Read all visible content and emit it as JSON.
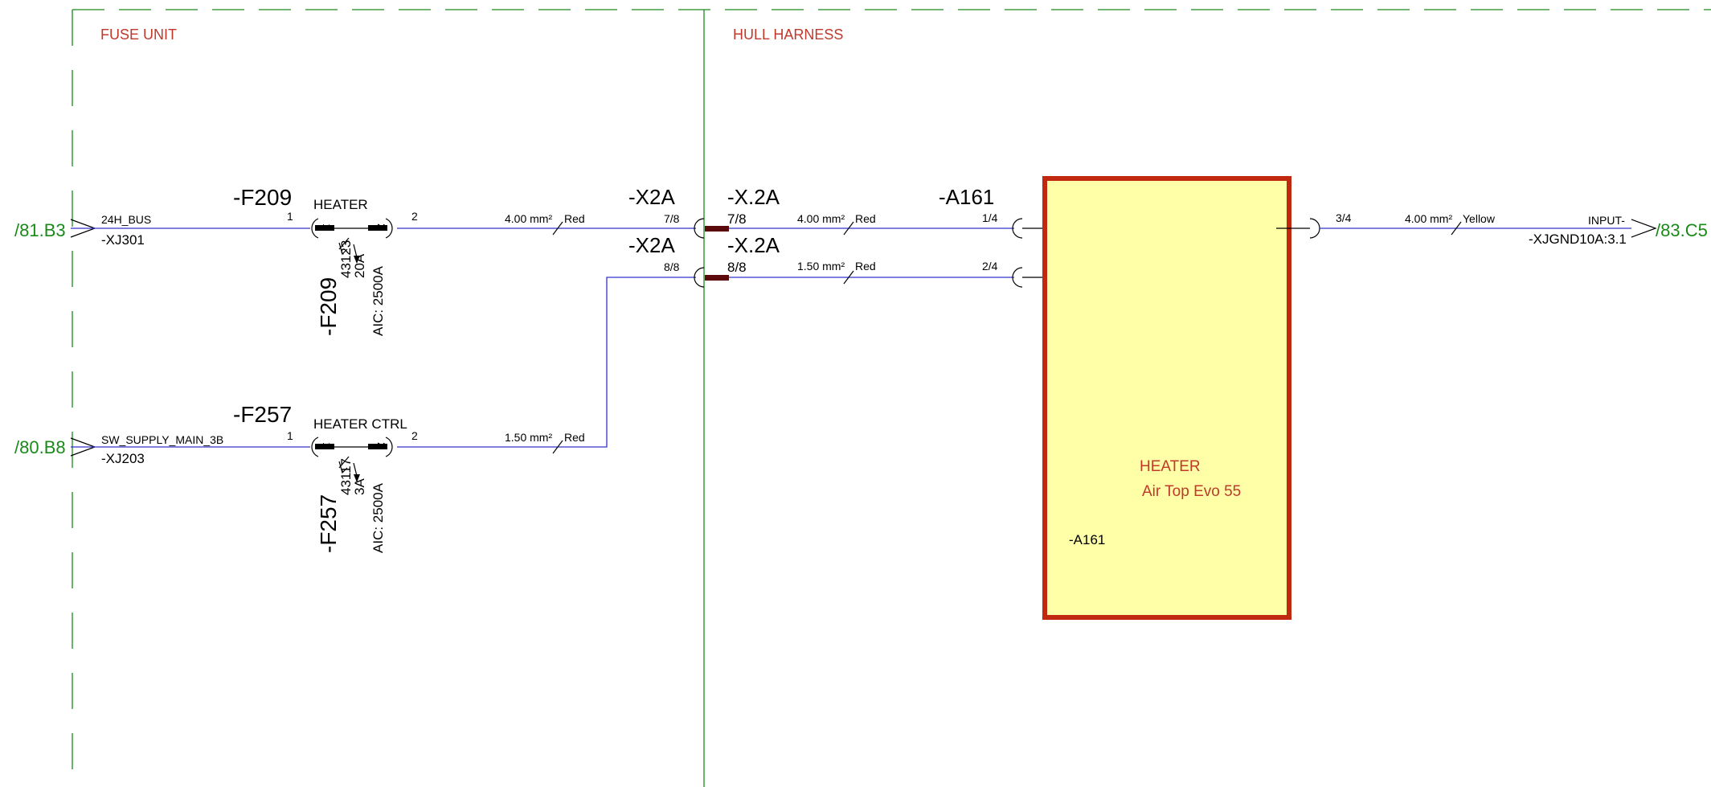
{
  "areas": {
    "fuse_unit": "FUSE UNIT",
    "hull_harness": "HULL HARNESS"
  },
  "refs": {
    "in1": "/81.B3",
    "in2": "/80.B8",
    "out1": "/83.C5"
  },
  "wire1": {
    "bus": "24H_BUS",
    "connector": "-XJ301",
    "fuse_tag": "-F209",
    "fuse_name": "HEATER",
    "pin_in": "1",
    "pin_out": "2",
    "spec_size": "4.00 mm²",
    "spec_color": "Red",
    "fuse_tag_v": "-F209",
    "fuse_part": "43123",
    "fuse_rating": "20A",
    "fuse_aic": "AIC: 2500A"
  },
  "wire2": {
    "bus": "SW_SUPPLY_MAIN_3B",
    "connector": "-XJ203",
    "fuse_tag": "-F257",
    "fuse_name": "HEATER CTRL",
    "pin_in": "1",
    "pin_out": "2",
    "spec_size": "1.50 mm²",
    "spec_color": "Red",
    "fuse_tag_v": "-F257",
    "fuse_part": "43117",
    "fuse_rating": "3A",
    "fuse_aic": "AIC: 2500A"
  },
  "conn_x2a": {
    "tag_left_1": "-X2A",
    "tag_left_2": "-X2A",
    "pin_left_1": "7/8",
    "pin_left_2": "8/8",
    "tag_right_1": "-X.2A",
    "tag_right_2": "-X.2A",
    "pin_right_1": "7/8",
    "pin_right_2": "8/8"
  },
  "harness": {
    "w1_size": "4.00 mm²",
    "w1_color": "Red",
    "w2_size": "1.50 mm²",
    "w2_color": "Red",
    "a161_tag": "-A161",
    "pin1": "1/4",
    "pin2": "2/4"
  },
  "heater": {
    "title": "HEATER",
    "model": "Air Top Evo 55",
    "tag": "-A161",
    "fill": "#ffffa8",
    "border": "#c0290f"
  },
  "output": {
    "pin": "3/4",
    "size": "4.00 mm²",
    "color": "Yellow",
    "signal": "INPUT-",
    "connector": "-XJGND10A:3.1"
  }
}
